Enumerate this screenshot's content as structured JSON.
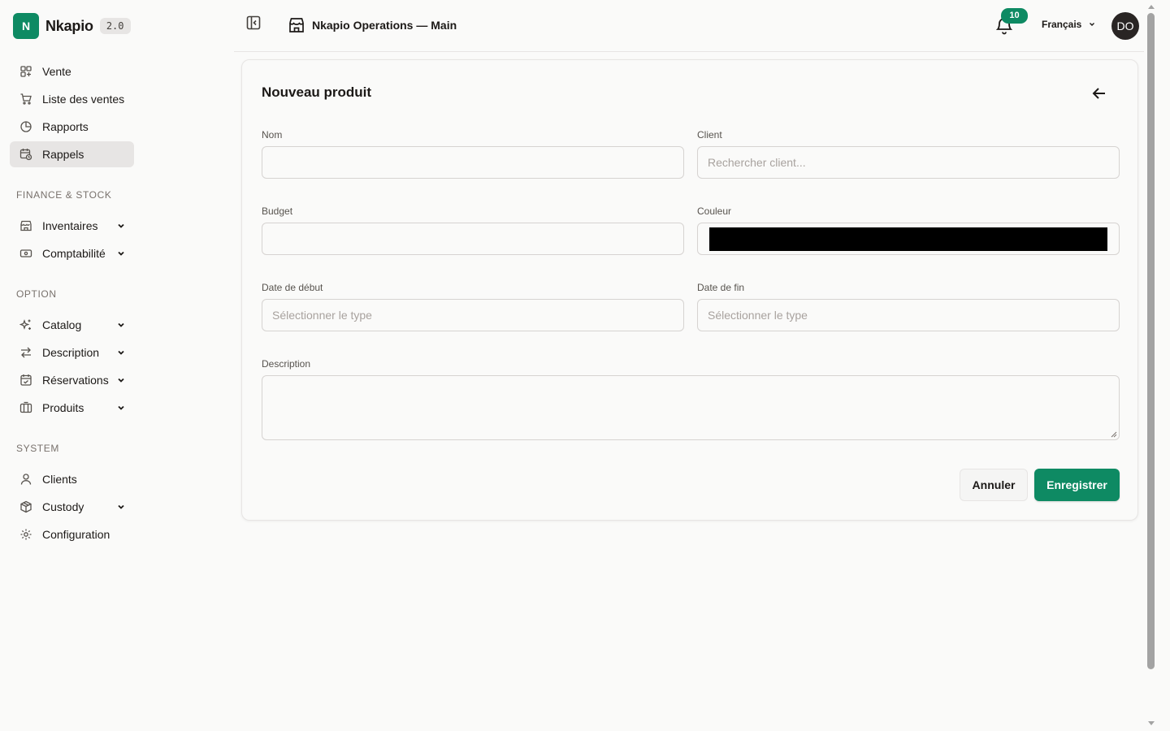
{
  "brand": {
    "logo_letter": "N",
    "name": "Nkapio",
    "version": "2.0"
  },
  "sidebar": {
    "main_items": [
      {
        "label": "Vente",
        "icon": "grid-plus-icon"
      },
      {
        "label": "Liste des ventes",
        "icon": "cart-icon"
      },
      {
        "label": "Rapports",
        "icon": "pie-chart-icon"
      },
      {
        "label": "Rappels",
        "icon": "calendar-clock-icon",
        "active": true
      }
    ],
    "sections": [
      {
        "title": "FINANCE & STOCK",
        "items": [
          {
            "label": "Inventaires",
            "icon": "store-icon",
            "expandable": true
          },
          {
            "label": "Comptabilité",
            "icon": "banknote-icon",
            "expandable": true
          }
        ]
      },
      {
        "title": "OPTION",
        "items": [
          {
            "label": "Catalog",
            "icon": "sparkles-icon",
            "expandable": true
          },
          {
            "label": "Description",
            "icon": "arrows-left-right-icon",
            "expandable": true
          },
          {
            "label": "Réservations",
            "icon": "calendar-check-icon",
            "expandable": true
          },
          {
            "label": "Produits",
            "icon": "box-icon",
            "expandable": true
          }
        ]
      },
      {
        "title": "SYSTEM",
        "items": [
          {
            "label": "Clients",
            "icon": "user-icon",
            "expandable": false
          },
          {
            "label": "Custody",
            "icon": "package-icon",
            "expandable": true
          },
          {
            "label": "Configuration",
            "icon": "gear-icon",
            "expandable": false
          }
        ]
      }
    ]
  },
  "topbar": {
    "store_name": "Nkapio Operations — Main",
    "notification_count": "10",
    "language": "Français",
    "avatar_initials": "DO"
  },
  "form": {
    "title": "Nouveau produit",
    "fields": {
      "nom": {
        "label": "Nom",
        "value": "",
        "placeholder": ""
      },
      "client": {
        "label": "Client",
        "value": "",
        "placeholder": "Rechercher client..."
      },
      "budget": {
        "label": "Budget",
        "value": "",
        "placeholder": ""
      },
      "couleur": {
        "label": "Couleur",
        "value": "#000000"
      },
      "date_debut": {
        "label": "Date de début",
        "placeholder": "Sélectionner le type"
      },
      "date_fin": {
        "label": "Date de fin",
        "placeholder": "Sélectionner le type"
      },
      "description": {
        "label": "Description",
        "value": ""
      }
    },
    "cancel_label": "Annuler",
    "save_label": "Enregistrer"
  },
  "colors": {
    "accent": "#0e8a63",
    "background": "#fafaf9",
    "active_nav": "#e7e5e4"
  }
}
